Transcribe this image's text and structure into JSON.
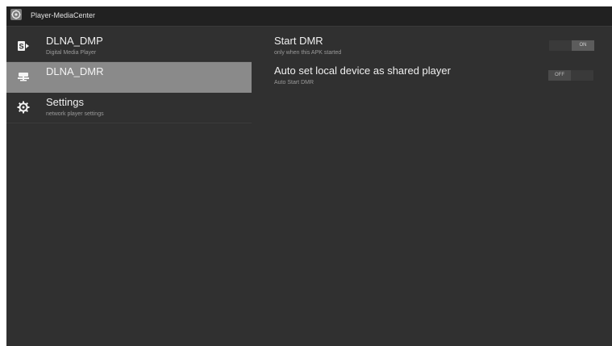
{
  "app": {
    "title": "Player-MediaCenter",
    "icon": "gear-globe-icon"
  },
  "sidebar": {
    "items": [
      {
        "title": "DLNA_DMP",
        "subtitle": "Digital Media Player",
        "icon": "dmp-icon",
        "selected": false
      },
      {
        "title": "DLNA_DMR",
        "subtitle": "",
        "icon": "dmr-icon",
        "selected": true
      },
      {
        "title": "Settings",
        "subtitle": "network player settings",
        "icon": "gear-icon",
        "selected": false
      }
    ]
  },
  "settings": [
    {
      "title": "Start DMR",
      "subtitle": "only when this APK started",
      "toggle": "ON"
    },
    {
      "title": "Auto set local device as shared player",
      "subtitle": "Auto Start DMR",
      "toggle": "OFF"
    }
  ],
  "colors": {
    "background": "#303030",
    "titlebar": "#212121",
    "selected": "#8a8a8a"
  }
}
